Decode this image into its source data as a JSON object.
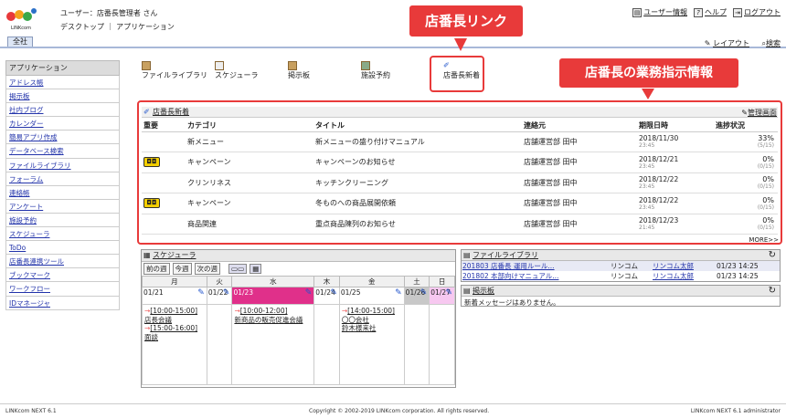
{
  "header": {
    "user": "ユーザー：店番長管理者 さん",
    "nav": [
      "デスクトップ",
      "アプリケーション"
    ],
    "links": [
      "ユーザー情報",
      "ヘルプ",
      "ログアウト"
    ],
    "all_tab": "全社",
    "layout": "レイアウト",
    "search": "検索",
    "logo_text": "LINKcom"
  },
  "sidebar": {
    "header": "アプリケーション",
    "items": [
      "アドレス帳",
      "掲示板",
      "社内ブログ",
      "カレンダー",
      "簡易アプリ作成",
      "データベース検索",
      "ファイルライブラリ",
      "フォーラム",
      "連絡帳",
      "アンケート",
      "施設予約",
      "スケジューラ",
      "ToDo",
      "店番長連携ツール",
      "ブックマーク",
      "ワークフロー",
      "IDマネージャ"
    ]
  },
  "apps": [
    "ファイルライブラリ",
    "スケジューラ",
    "掲示板",
    "施設予約",
    "店番長新着"
  ],
  "callouts": {
    "c1": "店番長リンク",
    "c2": "店番長の業務指示情報"
  },
  "tasks": {
    "title": "店番長新着",
    "admin": "管理画面",
    "cols": [
      "重要",
      "カテゴリ",
      "タイトル",
      "連絡元",
      "期限日時",
      "進捗状況"
    ],
    "rows": [
      {
        "imp": "",
        "cat": "新メニュー",
        "title": "新メニューの盛り付けマニュアル",
        "from": "店舗運営部 田中",
        "date": "2018/11/30",
        "time": "23:45",
        "pct": "33%",
        "cnt": "(5/15)"
      },
      {
        "imp": "重",
        "cat": "キャンペーン",
        "title": "キャンペーンのお知らせ",
        "from": "店舗運営部 田中",
        "date": "2018/12/21",
        "time": "23:45",
        "pct": "0%",
        "cnt": "(0/15)"
      },
      {
        "imp": "",
        "cat": "クリンリネス",
        "title": "キッチンクリーニング",
        "from": "店舗運営部 田中",
        "date": "2018/12/22",
        "time": "23:45",
        "pct": "0%",
        "cnt": "(0/15)"
      },
      {
        "imp": "重",
        "cat": "キャンペーン",
        "title": "冬ものへの商品展開依頼",
        "from": "店舗運営部 田中",
        "date": "2018/12/22",
        "time": "23:45",
        "pct": "0%",
        "cnt": "(0/15)"
      },
      {
        "imp": "",
        "cat": "商品関連",
        "title": "重点商品陳列のお知らせ",
        "from": "店舗運営部 田中",
        "date": "2018/12/23",
        "time": "21:45",
        "pct": "0%",
        "cnt": "(0/15)"
      }
    ],
    "more": "MORE>>"
  },
  "scheduler": {
    "title": "スケジューラ",
    "nav": [
      "前の週",
      "今週",
      "次の週"
    ],
    "days": [
      "月",
      "火",
      "水",
      "木",
      "金",
      "土",
      "日"
    ],
    "dates": [
      "01/21",
      "01/22",
      "01/23",
      "01/24",
      "01/25",
      "01/26",
      "01/27"
    ],
    "ev_mon": [
      "[10:00-15:00]",
      "店長会議",
      "[15:00-16:00]",
      "面談"
    ],
    "ev_wed": [
      "[10:00-12:00]",
      "新商品の販売促進会議"
    ],
    "ev_fri": [
      "[14:00-15:00]",
      "〇〇会社",
      "鈴木様来社"
    ]
  },
  "library": {
    "title": "ファイルライブラリ",
    "rows": [
      [
        "201803 店番長 運用ルール...",
        "リンコム",
        "リンコム太郎",
        "01/23 14:25"
      ],
      [
        "201802 本部向けマニュアル...",
        "リンコム",
        "リンコム太郎",
        "01/23 14:25"
      ]
    ]
  },
  "bbs": {
    "title": "掲示板",
    "msg": "新着メッセージはありません。"
  },
  "footer": {
    "left": "LINKcom NEXT 6.1",
    "center": "Copyright © 2002-2019 LINKcom corporation. All rights reserved.",
    "right": "LINKcom NEXT 6.1 administrator"
  },
  "colors": {
    "accent": "#e83a3a",
    "today": "#e0308a",
    "sat": "#c8c8c8",
    "sun": "#f7c8f0"
  }
}
